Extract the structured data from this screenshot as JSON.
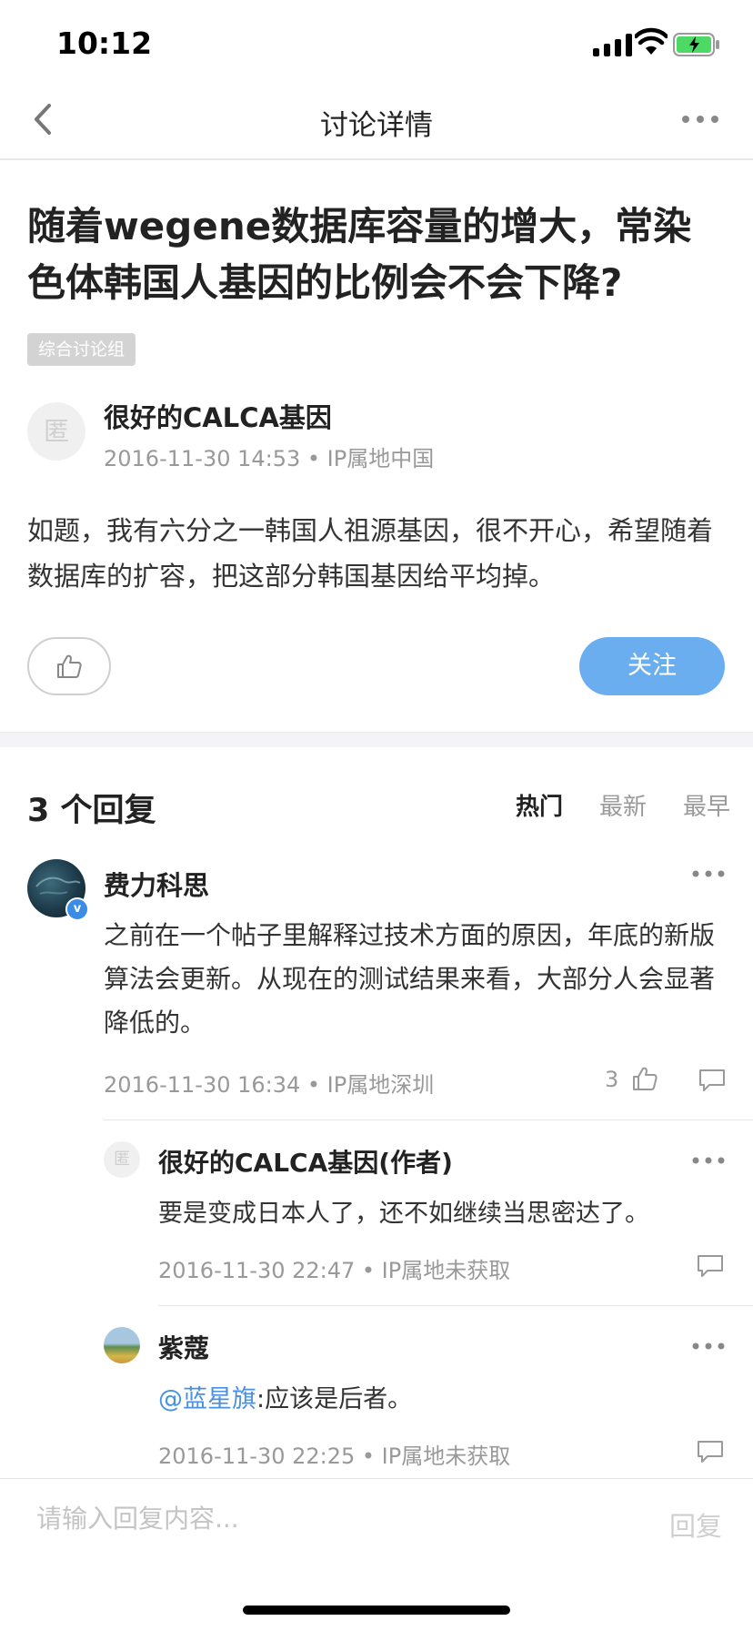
{
  "status_bar": {
    "time": "10:12"
  },
  "navbar": {
    "title": "讨论详情"
  },
  "post": {
    "title": "随着wegene数据库容量的增大，常染色体韩国人基因的比例会不会下降?",
    "group_tag": "综合讨论组",
    "author": {
      "avatar_text": "匿",
      "name": "很好的CALCA基因",
      "meta": "2016-11-30 14:53 • IP属地中国"
    },
    "body": "如题，我有六分之一韩国人祖源基因，很不开心，希望随着数据库的扩容，把这部分韩国基因给平均掉。",
    "follow_label": "关注"
  },
  "replies": {
    "count_label": "3 个回复",
    "sort_tabs": [
      {
        "label": "热门",
        "active": true
      },
      {
        "label": "最新",
        "active": false
      },
      {
        "label": "最早",
        "active": false
      }
    ],
    "items": [
      {
        "name": "费力科思",
        "verified_badge": "v",
        "body": "之前在一个帖子里解释过技术方面的原因，年底的新版算法会更新。从现在的测试结果来看，大部分人会显著降低的。",
        "meta": "2016-11-30 16:34 • IP属地深圳",
        "likes": "3",
        "sub_replies": [
          {
            "avatar_text": "匿",
            "name": "很好的CALCA基因(作者)",
            "body": "要是变成日本人了，还不如继续当思密达了。",
            "meta": "2016-11-30 22:47 • IP属地未获取"
          },
          {
            "name": "紫蔻",
            "mention": "@蓝星旗",
            "body": ":应该是后者。",
            "meta": "2016-11-30 22:25 • IP属地未获取"
          }
        ]
      }
    ]
  },
  "reply_bar": {
    "placeholder": "请输入回复内容...",
    "send_label": "回复"
  },
  "colors": {
    "accent": "#6aaef0",
    "mention": "#4a90e2",
    "muted_text": "#999999"
  },
  "icons": [
    "back-icon",
    "more-icon",
    "thumbs-up-icon",
    "comment-icon",
    "verified-icon",
    "wifi-icon",
    "battery-icon",
    "signal-icon"
  ]
}
